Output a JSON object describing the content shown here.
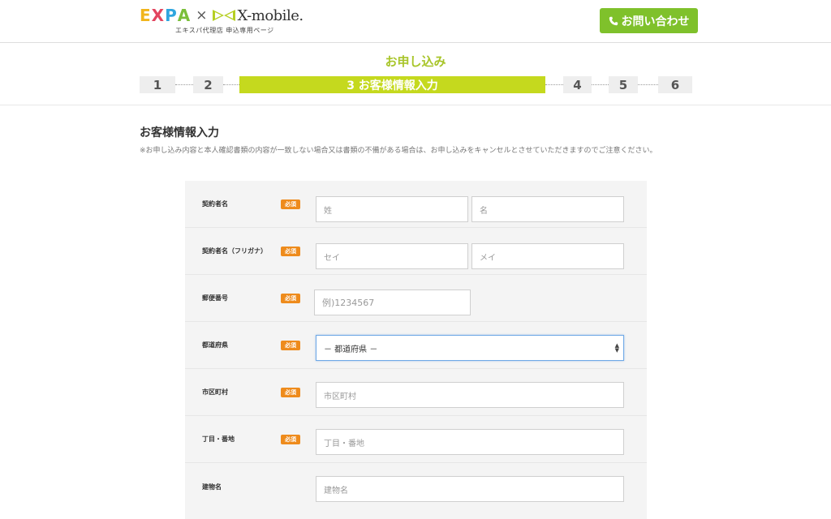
{
  "header": {
    "logo_expa_letters": [
      "E",
      "X",
      "P",
      "A"
    ],
    "logo_expa_colors": [
      "#f1b51c",
      "#e2455f",
      "#2fa6df",
      "#7bbf3a"
    ],
    "logo_times": "×",
    "logo_xmobile": "X-mobile.",
    "logo_sub": "エキスパ代理店 申込専用ページ",
    "contact_label": "お問い合わせ",
    "accent_color": "#7fc12b"
  },
  "steps": {
    "title": "お申し込み",
    "items": [
      "1",
      "2",
      "3 お客様情報入力",
      "4",
      "5",
      "6"
    ],
    "active_index": 2
  },
  "content": {
    "section_title": "お客様情報入力",
    "note": "※お申し込み内容と本人確認書類の内容が一致しない場合又は書類の不備がある場合は、お申し込みをキャンセルとさせていただきますのでご注意ください。"
  },
  "form": {
    "required_label": "必須",
    "rows": [
      {
        "label": "契約者名",
        "required": true,
        "fields": [
          {
            "placeholder": "姓"
          },
          {
            "placeholder": "名"
          }
        ]
      },
      {
        "label": "契約者名（フリガナ）",
        "required": true,
        "fields": [
          {
            "placeholder": "セイ"
          },
          {
            "placeholder": "メイ"
          }
        ]
      },
      {
        "label": "郵便番号",
        "required": true,
        "fields": [
          {
            "placeholder": "例)1234567"
          }
        ]
      },
      {
        "label": "都道府県",
        "required": true,
        "fields": [
          {
            "value": "－ 都道府県 －"
          }
        ]
      },
      {
        "label": "市区町村",
        "required": true,
        "fields": [
          {
            "placeholder": "市区町村"
          }
        ]
      },
      {
        "label": "丁目・番地",
        "required": true,
        "fields": [
          {
            "placeholder": "丁目・番地"
          }
        ]
      },
      {
        "label": "建物名",
        "required": false,
        "fields": [
          {
            "placeholder": "建物名"
          }
        ]
      }
    ]
  }
}
